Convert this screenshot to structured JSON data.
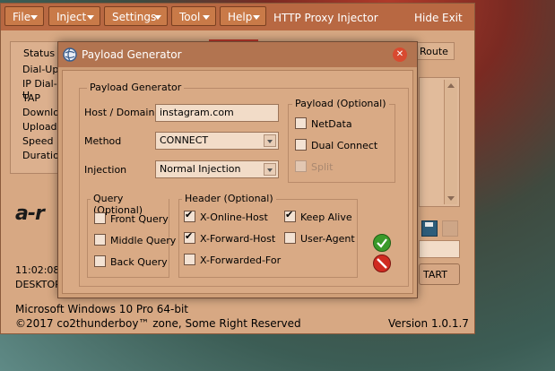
{
  "menu": {
    "file": "File",
    "inject": "Inject",
    "settings": "Settings",
    "tool": "Tool",
    "help": "Help"
  },
  "app": {
    "title": "HTTP Proxy Injector",
    "hide": "Hide",
    "exit": "Exit",
    "status_group": "Status I",
    "route_tab": "Route",
    "status_items": [
      "Dial-Up",
      "IP Dial-U",
      "TAP",
      "Downlo",
      "Upload",
      "Speed",
      "Duration"
    ],
    "logo_text": "a-r",
    "time_text": "11:02:08 A",
    "desktop_text": "DESKTOP-",
    "start_button": "TART",
    "os_info": "Microsoft Windows 10 Pro 64-bit",
    "copyright": "©2017 co2thunderboy™ zone, Some Right Reserved",
    "version": "Version 1.0.1.7"
  },
  "dialog": {
    "title": "Payload Generator",
    "group_title": "Payload Generator",
    "host_label": "Host / Domain",
    "host_value": "instagram.com",
    "method_label": "Method",
    "method_value": "CONNECT",
    "injection_label": "Injection",
    "injection_value": "Normal Injection",
    "payload_optional": {
      "title": "Payload (Optional)",
      "netdata": "NetData",
      "dual_connect": "Dual Connect",
      "split": "Split"
    },
    "query_optional": {
      "title": "Query (Optional)",
      "front": "Front Query",
      "middle": "Middle Query",
      "back": "Back Query"
    },
    "header_optional": {
      "title": "Header (Optional)",
      "x_online_host": "X-Online-Host",
      "keep_alive": "Keep Alive",
      "x_forward_host": "X-Forward-Host",
      "user_agent": "User-Agent",
      "x_forwarded_for": "X-Forwarded-For"
    }
  },
  "colors": {
    "menubar": "#b86842",
    "window": "#d7a883",
    "dialog_title": "#b27450",
    "ok_green": "#3a9a2a",
    "cancel_red": "#d02a20"
  }
}
